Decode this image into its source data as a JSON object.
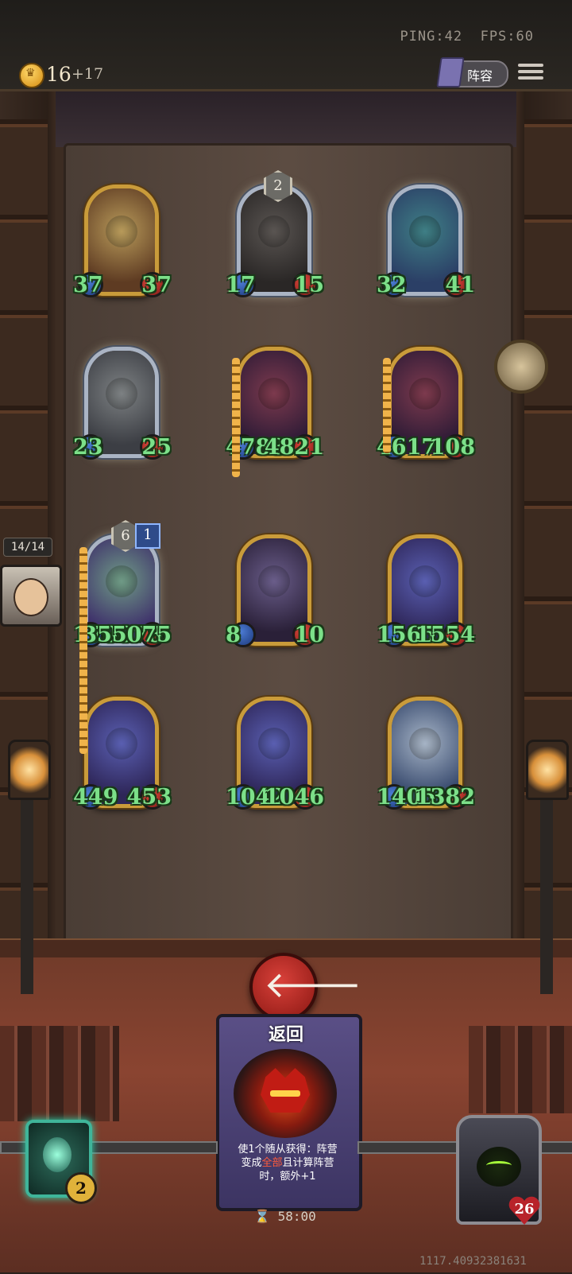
{
  "status": {
    "ping": "PING:42",
    "fps": "FPS:60"
  },
  "resources": {
    "gold": "16",
    "gold_income": "+17"
  },
  "header": {
    "lineup_label": "阵容"
  },
  "side": {
    "hand_count": "14/14"
  },
  "board": {
    "rows": [
      [
        {
          "attack": "37",
          "health": "37",
          "frame": "gold",
          "art": "dragon"
        },
        {
          "attack": "17",
          "health": "15",
          "frame": "silver",
          "level": "2",
          "art": "knight"
        },
        {
          "attack": "32",
          "health": "41",
          "frame": "silver",
          "art": "naga"
        }
      ],
      [
        {
          "attack": "23",
          "health": "25",
          "frame": "silver",
          "art": "ram"
        },
        {
          "attack": "4788",
          "health": "4821",
          "frame": "gold",
          "art": "serpent"
        },
        {
          "attack": "4617",
          "health": "108",
          "frame": "gold",
          "art": "serpent"
        }
      ],
      [
        {
          "attack": "170078",
          "health": "355075",
          "frame": "silver",
          "level": "6",
          "tier": "1",
          "art": "seahorse"
        },
        {
          "attack": "8",
          "health": "10",
          "frame": "gold",
          "art": "beast"
        },
        {
          "attack": "1565",
          "health": "1554",
          "frame": "gold",
          "art": "sorceress"
        }
      ],
      [
        {
          "attack": "449",
          "health": "453",
          "frame": "gold",
          "art": "sorceress"
        },
        {
          "attack": "1042",
          "health": "1046",
          "frame": "gold",
          "art": "sorceress"
        },
        {
          "attack": "1405",
          "health": "1382",
          "frame": "gold",
          "art": "king"
        }
      ]
    ]
  },
  "spell_card": {
    "title": "返回",
    "desc_1": "使1个随从获得：阵营",
    "desc_2a": "变成",
    "desc_2b": "全部",
    "desc_2c": "且计算阵营",
    "desc_3": "时，额外+1"
  },
  "hero_power": {
    "cost": "2"
  },
  "opponent": {
    "health": "26"
  },
  "footer": {
    "timer": "58:00",
    "debug_value": "1117.40932381631"
  },
  "colors": {
    "stat_text": "#7ce089",
    "gold_frame": "#c99b3a",
    "silver_frame": "#aab4c4",
    "attack_gem": "#2e5ab0",
    "health_gem": "#b02a22"
  }
}
